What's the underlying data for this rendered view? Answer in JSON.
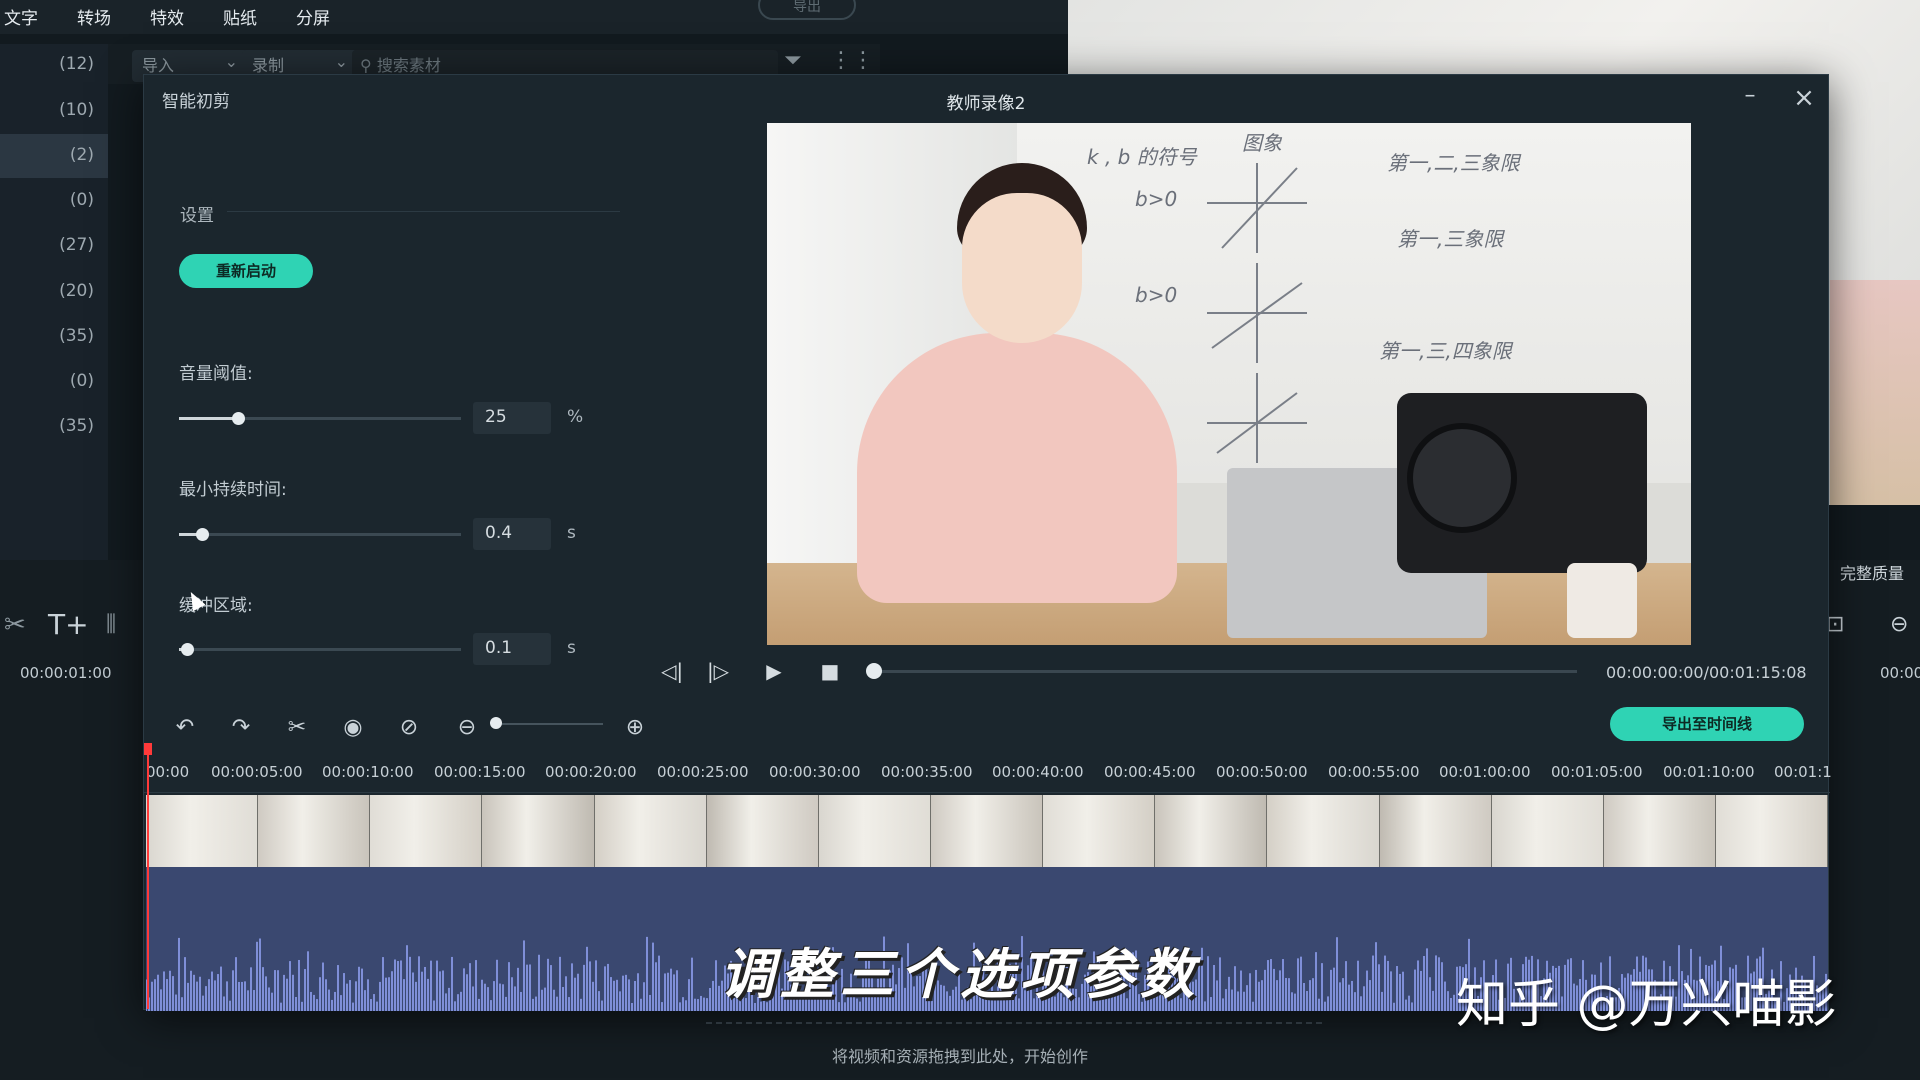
{
  "background_app": {
    "menu": [
      "文字",
      "转场",
      "特效",
      "贴纸",
      "分屏"
    ],
    "export_button": "导出",
    "toolbar": {
      "import_label": "导入",
      "record_label": "录制",
      "search_placeholder": "搜索素材"
    },
    "category_counts": [
      "(12)",
      "(10)",
      "(2)",
      "(0)",
      "(27)",
      "(20)",
      "(35)",
      "(0)",
      "(35)"
    ],
    "timeline_timecode": "00:00:01:00",
    "right_timecode": "00:00",
    "quality_label": "完整质量",
    "drop_hint": "将视频和资源拖拽到此处，开始创作"
  },
  "modal": {
    "title": "智能初剪",
    "filename": "教师录像2",
    "settings": {
      "section_label": "设置",
      "restart_button": "重新启动",
      "params": [
        {
          "label": "音量阈值:",
          "value": "25",
          "unit": "%",
          "fraction": 0.21
        },
        {
          "label": "最小持续时间:",
          "value": "0.4",
          "unit": "s",
          "fraction": 0.08
        },
        {
          "label": "缓冲区域:",
          "value": "0.1",
          "unit": "s",
          "fraction": 0.03
        }
      ]
    },
    "preview": {
      "board_text": [
        "k , b 的符号",
        "图象",
        "第一,二,三象限",
        "b>0",
        "第一,三象限",
        "b>0",
        "第一,三,四象限"
      ]
    },
    "playback": {
      "time": "00:00:00:00/00:01:15:08",
      "progress": 0.0
    },
    "export_to_timeline_button": "导出至时间线",
    "ruler_ticks": [
      "00:00",
      "00:00:05:00",
      "00:00:10:00",
      "00:00:15:00",
      "00:00:20:00",
      "00:00:25:00",
      "00:00:30:00",
      "00:00:35:00",
      "00:00:40:00",
      "00:00:45:00",
      "00:00:50:00",
      "00:00:55:00",
      "00:01:00:00",
      "00:01:05:00",
      "00:01:10:00",
      "00:01:1"
    ]
  },
  "overlay": {
    "caption": "调整三个选项参数",
    "watermark": "知乎 @万兴喵影"
  },
  "colors": {
    "accent": "#2fd3b4",
    "audio_track": "#3a4870",
    "waveform": "#7f8fd8",
    "playhead": "#ff3a3a"
  }
}
